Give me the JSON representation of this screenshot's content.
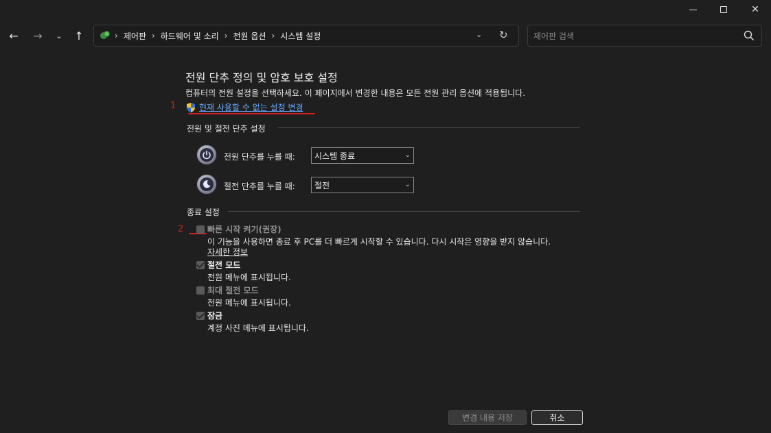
{
  "address": {
    "crumbs": [
      "제어판",
      "하드웨어 및 소리",
      "전원 옵션",
      "시스템 설정"
    ]
  },
  "search": {
    "placeholder": "제어판 검색"
  },
  "page": {
    "title": "전원 단추 정의 및 암호 보호 설정",
    "description": "컴퓨터의 전원 설정을 선택하세요. 이 페이지에서 변경한 내용은 모든 전원 관리 옵션에 적용됩니다.",
    "change_link": "현재 사용할 수 없는 설정 변경"
  },
  "annotations": {
    "one": "1",
    "two": "2",
    "color": "#d21f1f"
  },
  "power_section": {
    "header": "전원 및 절전 단추 설정",
    "power_button_label": "전원 단추를 누를 때:",
    "power_button_value": "시스템 종료",
    "sleep_button_label": "절전 단추를 누를 때:",
    "sleep_button_value": "절전"
  },
  "shutdown_section": {
    "header": "종료 설정",
    "fast_startup_label": "빠른 시작 켜기(권장)",
    "fast_startup_desc": "이 기능을 사용하면 종료 후 PC를 더 빠르게 시작할 수 있습니다. 다시 시작은 영향을 받지 않습니다.",
    "more_info": "자세한 정보",
    "sleep_label": "절전 모드",
    "sleep_desc": "전원 메뉴에 표시됩니다.",
    "hibernate_label": "최대 절전 모드",
    "hibernate_desc": "전원 메뉴에 표시됩니다.",
    "lock_label": "잠금",
    "lock_desc": "계정 사진 메뉴에 표시됩니다."
  },
  "footer": {
    "save_label": "변경 내용 저장",
    "cancel_label": "취소"
  },
  "colors": {
    "link": "#6aa8ff",
    "background": "#1f1f1f"
  }
}
